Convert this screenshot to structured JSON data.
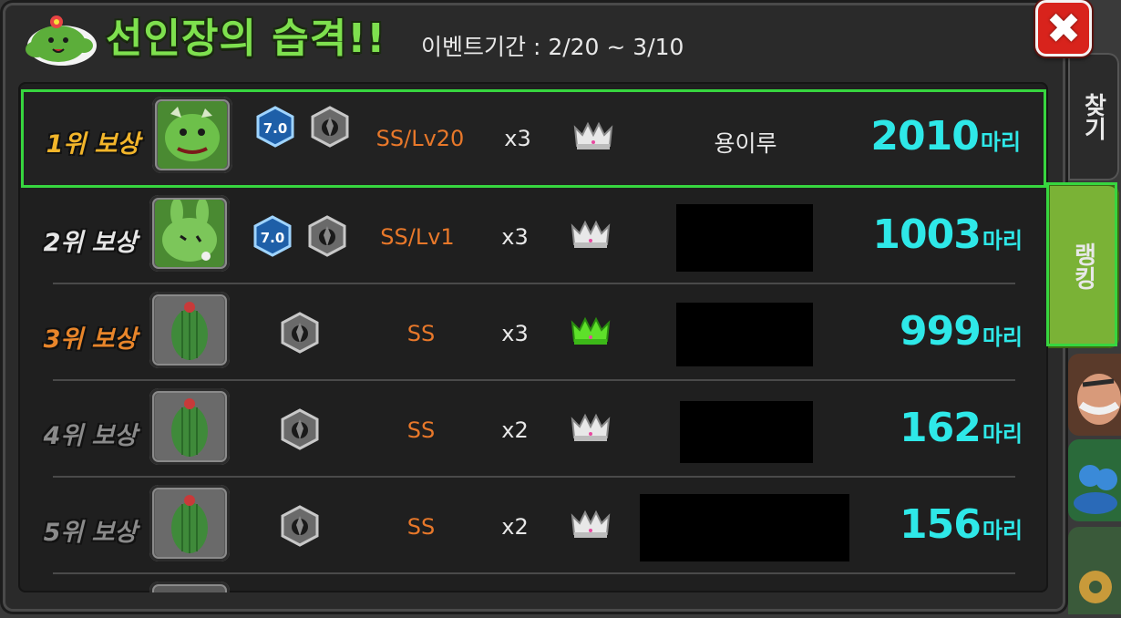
{
  "header": {
    "title": "선인장의 습격!!",
    "period": "이벤트기간 : 2/20 ~ 3/10"
  },
  "close_icon": "close-icon",
  "side_tabs": [
    {
      "label": "찾기",
      "active": false
    },
    {
      "label": "랭킹",
      "active": true
    }
  ],
  "rows": [
    {
      "rank": "1위 보상",
      "rank_color": "#f2b52a",
      "level_badge": "7.0",
      "grade": "SS/Lv20",
      "multiplier": "x3",
      "crown_color": "silver",
      "name": "용이루",
      "score": "2010",
      "unit": "마리",
      "selected": true
    },
    {
      "rank": "2위 보상",
      "rank_color": "#e6e6e6",
      "level_badge": "7.0",
      "grade": "SS/Lv1",
      "multiplier": "x3",
      "crown_color": "silver",
      "name": "",
      "score": "1003",
      "unit": "마리"
    },
    {
      "rank": "3위 보상",
      "rank_color": "#e8852a",
      "level_badge": "",
      "grade": "SS",
      "multiplier": "x3",
      "crown_color": "green",
      "name": "",
      "score": "999",
      "unit": "마리"
    },
    {
      "rank": "4위 보상",
      "rank_color": "#8a8a8a",
      "level_badge": "",
      "grade": "SS",
      "multiplier": "x2",
      "crown_color": "silver",
      "name": "",
      "score": "162",
      "unit": "마리"
    },
    {
      "rank": "5위 보상",
      "rank_color": "#8a8a8a",
      "level_badge": "",
      "grade": "SS",
      "multiplier": "x2",
      "crown_color": "silver",
      "name": "",
      "score": "156",
      "unit": "마리"
    }
  ],
  "colors": {
    "title_green": "#7ee04e",
    "score_cyan": "#2ee8e8",
    "grade_orange": "#e8782a",
    "selection_green": "#37d63f"
  }
}
